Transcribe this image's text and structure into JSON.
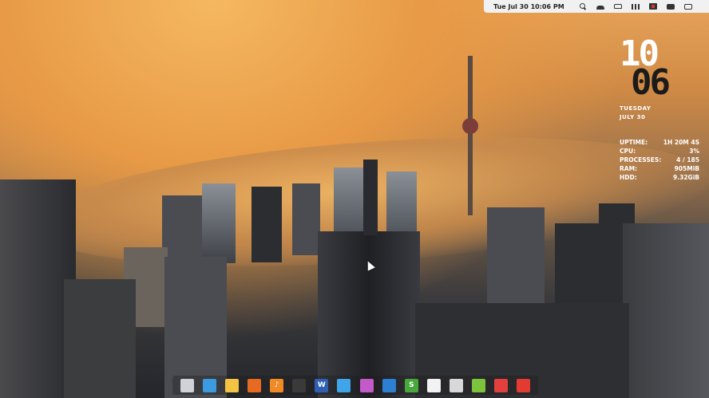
{
  "panel": {
    "datetime": "Tue Jul 30 10:06 PM",
    "tray_icons": [
      "search-icon",
      "cloud-icon",
      "car-icon",
      "signal-icon",
      "battery-icon",
      "chat-icon",
      "exit-icon"
    ]
  },
  "conky": {
    "hour": "10",
    "minute": "06",
    "weekday": "TUESDAY",
    "date": "JULY 30",
    "stats": [
      {
        "label": "UPTIME:",
        "value": "1H 20M 4S"
      },
      {
        "label": "CPU:",
        "value": "3%"
      },
      {
        "label": "PROCESSES:",
        "value": "4 / 185"
      },
      {
        "label": "RAM:",
        "value": "905MiB"
      },
      {
        "label": "HDD:",
        "value": "9.32GiB"
      }
    ]
  },
  "dock": {
    "items": [
      {
        "name": "files-dock-icon",
        "color": "#cfd2d6",
        "glyph": ""
      },
      {
        "name": "browser-dock-icon",
        "color": "#3b9be0",
        "glyph": ""
      },
      {
        "name": "mail-dock-icon",
        "color": "#f3c443",
        "glyph": ""
      },
      {
        "name": "firefox-dock-icon",
        "color": "#e76a22",
        "glyph": ""
      },
      {
        "name": "music-dock-icon",
        "color": "#f08a24",
        "glyph": "♪"
      },
      {
        "name": "terminal-dock-icon",
        "color": "#3a3a3a",
        "glyph": ""
      },
      {
        "name": "writer-dock-icon",
        "color": "#2f5fb3",
        "glyph": "W"
      },
      {
        "name": "chat-dock-icon",
        "color": "#3fa4e8",
        "glyph": ""
      },
      {
        "name": "video-dock-icon",
        "color": "#c45ac9",
        "glyph": ""
      },
      {
        "name": "document-dock-icon",
        "color": "#2d7fd1",
        "glyph": ""
      },
      {
        "name": "spreadsheet-dock-icon",
        "color": "#49a83b",
        "glyph": "S"
      },
      {
        "name": "text-file-dock-icon",
        "color": "#f2f2f2",
        "glyph": ""
      },
      {
        "name": "calculator-dock-icon",
        "color": "#d8d8d8",
        "glyph": ""
      },
      {
        "name": "download-dock-icon",
        "color": "#7cc43c",
        "glyph": ""
      },
      {
        "name": "calendar-dock-icon",
        "color": "#e2403d",
        "glyph": ""
      },
      {
        "name": "pdf-dock-icon",
        "color": "#e33a32",
        "glyph": ""
      }
    ]
  }
}
